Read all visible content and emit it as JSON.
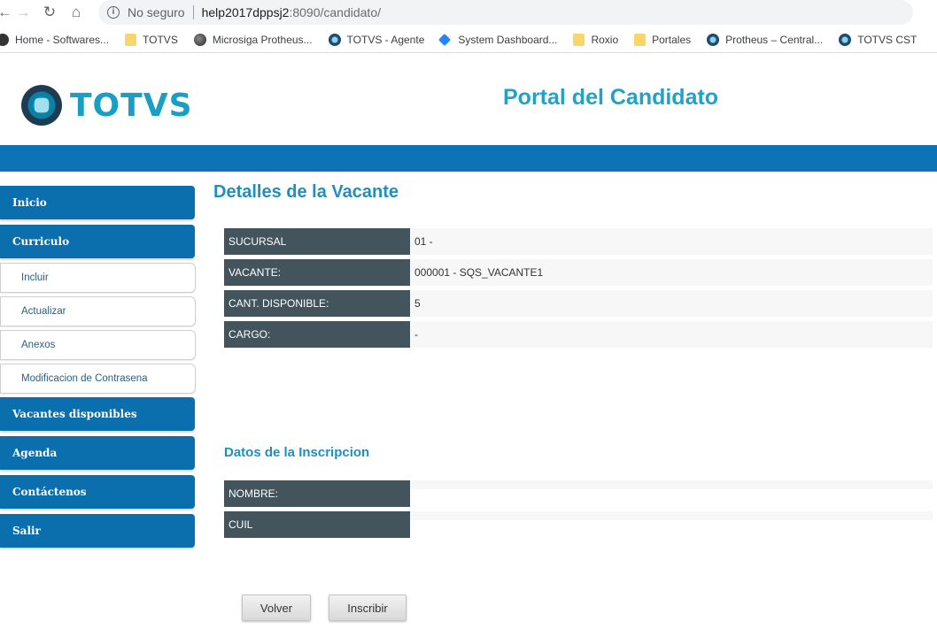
{
  "browser": {
    "security_label": "No seguro",
    "url_host": "help2017dppsj2",
    "url_rest": ":8090/candidato/",
    "bookmarks": [
      {
        "label": "Home - Softwares...",
        "icon": "home-icon"
      },
      {
        "label": "TOTVS",
        "icon": "folder-icon"
      },
      {
        "label": "Microsiga Protheus...",
        "icon": "globe-icon"
      },
      {
        "label": "TOTVS - Agente",
        "icon": "totvs-icon"
      },
      {
        "label": "System Dashboard...",
        "icon": "jira-icon"
      },
      {
        "label": "Roxio",
        "icon": "folder-icon"
      },
      {
        "label": "Portales",
        "icon": "folder-icon"
      },
      {
        "label": "Protheus – Central...",
        "icon": "totvs-icon"
      },
      {
        "label": "TOTVS CST",
        "icon": "totvs-icon"
      }
    ]
  },
  "header": {
    "logo_text": "TOTVS",
    "portal_title": "Portal del Candidato"
  },
  "sidebar": {
    "items": [
      {
        "label": "Inicio",
        "type": "main"
      },
      {
        "label": "Curriculo",
        "type": "main"
      },
      {
        "label": "Incluir",
        "type": "sub"
      },
      {
        "label": "Actualizar",
        "type": "sub"
      },
      {
        "label": "Anexos",
        "type": "sub"
      },
      {
        "label": "Modificacion de Contrasena",
        "type": "sub"
      },
      {
        "label": "Vacantes disponibles",
        "type": "main"
      },
      {
        "label": "Agenda",
        "type": "main"
      },
      {
        "label": "Contáctenos",
        "type": "main"
      },
      {
        "label": "Salir",
        "type": "main"
      }
    ]
  },
  "main": {
    "title": "Detalles de la Vacante",
    "details": [
      {
        "label": "SUCURSAL",
        "value": "01 -"
      },
      {
        "label": "VACANTE:",
        "value": "000001 - SQS_VACANTE1"
      },
      {
        "label": "CANT. DISPONIBLE:",
        "value": "5"
      },
      {
        "label": "CARGO:",
        "value": "-"
      }
    ],
    "inscription_title": "Datos de la Inscripcion",
    "inscription": [
      {
        "label": "NOMBRE:",
        "value": ""
      },
      {
        "label": "CUIL",
        "value": ""
      }
    ],
    "buttons": {
      "back_label": "Volver",
      "subscribe_label": "Inscribir"
    }
  },
  "colors": {
    "brand_blue": "#0c6fad",
    "title_cyan": "#23a2c4",
    "label_bg": "#43545c"
  }
}
